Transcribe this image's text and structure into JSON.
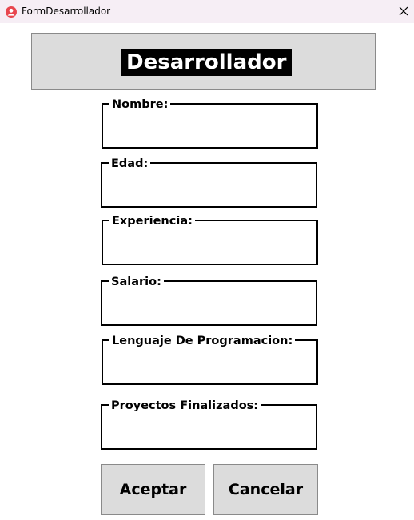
{
  "window": {
    "title": "FormDesarrollador",
    "icon": "user-circle-icon",
    "close_icon": "close-icon"
  },
  "header": {
    "title": "Desarrollador"
  },
  "fields": [
    {
      "label": "Nombre:",
      "value": ""
    },
    {
      "label": "Edad:",
      "value": ""
    },
    {
      "label": "Experiencia:",
      "value": ""
    },
    {
      "label": "Salario:",
      "value": ""
    },
    {
      "label": "Lenguaje De Programacion:",
      "value": ""
    },
    {
      "label": "Proyectos Finalizados:",
      "value": ""
    }
  ],
  "buttons": {
    "accept_label": "Aceptar",
    "cancel_label": "Cancelar"
  },
  "colors": {
    "titlebar": "#f6eef5",
    "panel": "#dcdcdc",
    "header_label_bg": "#000000",
    "header_label_fg": "#ffffff",
    "app_icon": "#e8464e"
  }
}
